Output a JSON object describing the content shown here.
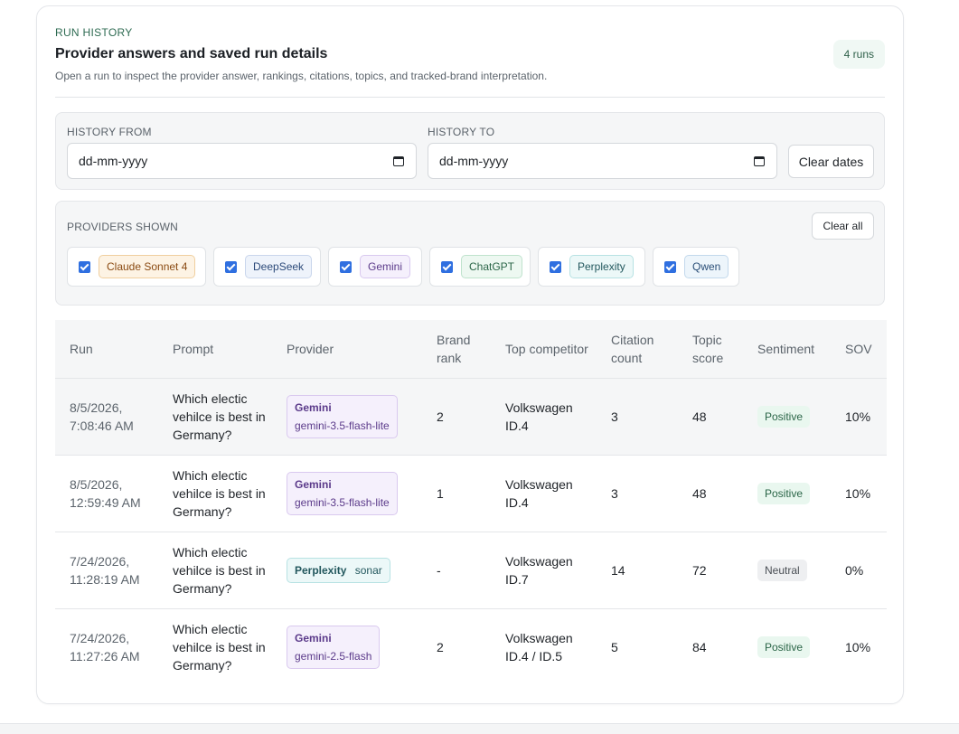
{
  "header": {
    "eyebrow": "RUN HISTORY",
    "title": "Provider answers and saved run details",
    "subtitle": "Open a run to inspect the provider answer, rankings, citations, topics, and tracked-brand interpretation.",
    "runs_badge": "4 runs"
  },
  "filters": {
    "history_from_label": "HISTORY FROM",
    "history_from_value": "dd-mm-yyyy",
    "history_to_label": "HISTORY TO",
    "history_to_value": "dd-mm-yyyy",
    "clear_dates_label": "Clear dates",
    "calendar_icon": "calendar-icon"
  },
  "providers": {
    "label": "PROVIDERS SHOWN",
    "clear_all_label": "Clear all",
    "items": [
      {
        "label": "Claude Sonnet 4",
        "checked": true,
        "color": "#8a4a12",
        "bg": "#fdf3e4",
        "border": "#f0cf9e"
      },
      {
        "label": "DeepSeek",
        "checked": true,
        "color": "#2c4a7a",
        "bg": "#eef3fb",
        "border": "#c9d6ec"
      },
      {
        "label": "Gemini",
        "checked": true,
        "color": "#5b3a8a",
        "bg": "#f5f0fc",
        "border": "#d9c9ef"
      },
      {
        "label": "ChatGPT",
        "checked": true,
        "color": "#2a6547",
        "bg": "#edf8f1",
        "border": "#bfe3cd"
      },
      {
        "label": "Perplexity",
        "checked": true,
        "color": "#23585e",
        "bg": "#ecf8f8",
        "border": "#b7e2e3"
      },
      {
        "label": "Qwen",
        "checked": true,
        "color": "#2b4f78",
        "bg": "#edf5fb",
        "border": "#c3d9ec"
      }
    ]
  },
  "table": {
    "columns": [
      "Run",
      "Prompt",
      "Provider",
      "Brand rank",
      "Top competitor",
      "Citation count",
      "Topic score",
      "Sentiment",
      "SOV"
    ],
    "rows": [
      {
        "run": "8/5/2026, 7:08:46 AM",
        "prompt": "Which electic vehilce is best in Germany?",
        "provider": "Gemini",
        "model": "gemini-3.5-flash-lite",
        "rank": "2",
        "competitor": "Volkswagen ID.4",
        "citations": "3",
        "topic": "48",
        "sentiment": "Positive",
        "sov": "10%"
      },
      {
        "run": "8/5/2026, 12:59:49 AM",
        "prompt": "Which electic vehilce is best in Germany?",
        "provider": "Gemini",
        "model": "gemini-3.5-flash-lite",
        "rank": "1",
        "competitor": "Volkswagen ID.4",
        "citations": "3",
        "topic": "48",
        "sentiment": "Positive",
        "sov": "10%"
      },
      {
        "run": "7/24/2026, 11:28:19 AM",
        "prompt": "Which electic vehilce is best in Germany?",
        "provider": "Perplexity",
        "model": "sonar",
        "rank": "-",
        "competitor": "Volkswagen ID.7",
        "citations": "14",
        "topic": "72",
        "sentiment": "Neutral",
        "sov": "0%"
      },
      {
        "run": "7/24/2026, 11:27:26 AM",
        "prompt": "Which electic vehilce is best in Germany?",
        "provider": "Gemini",
        "model": "gemini-2.5-flash",
        "rank": "2",
        "competitor": "Volkswagen ID.4 / ID.5",
        "citations": "5",
        "topic": "84",
        "sentiment": "Positive",
        "sov": "10%"
      }
    ]
  }
}
